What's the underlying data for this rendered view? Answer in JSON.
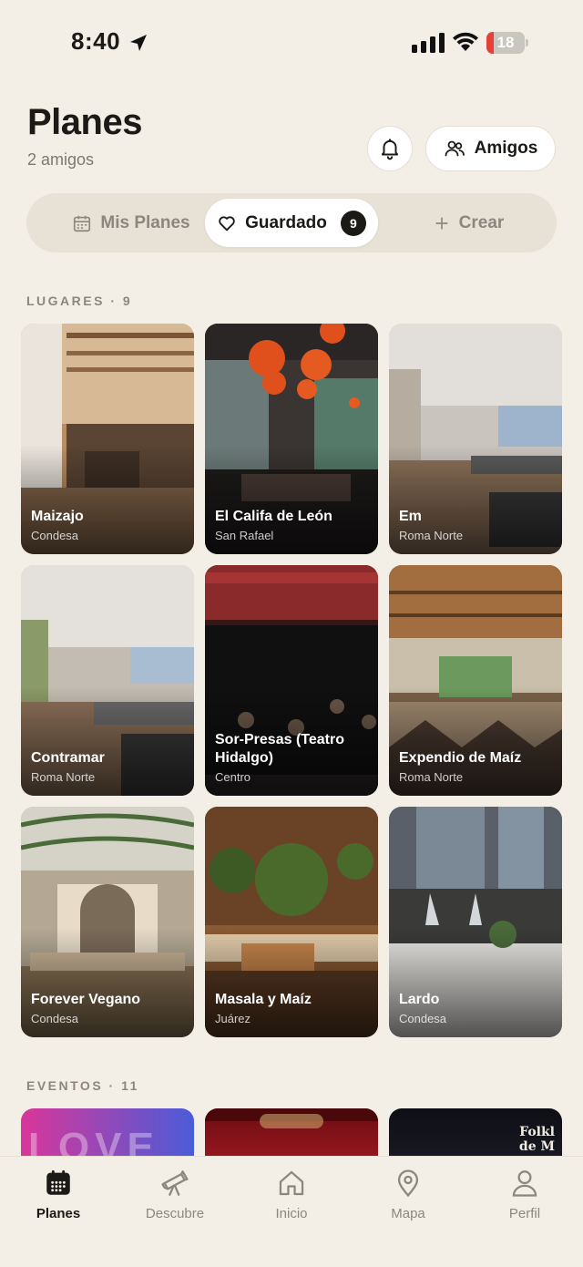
{
  "status": {
    "time": "8:40",
    "battery": "18",
    "battery_percent": 18
  },
  "header": {
    "title": "Planes",
    "subtitle": "2 amigos",
    "friends_button": "Amigos"
  },
  "tabs": [
    {
      "label": "Mis Planes",
      "icon": "calendar-icon",
      "selected": false
    },
    {
      "label": "Guardado",
      "icon": "heart-icon",
      "selected": true,
      "badge": "9"
    },
    {
      "label": "Crear",
      "icon": "plus-icon",
      "selected": false
    }
  ],
  "places_section": {
    "title": "LUGARES · 9"
  },
  "places": [
    {
      "name": "Maizajo",
      "area": "Condesa"
    },
    {
      "name": "El Califa de León",
      "area": "San Rafael"
    },
    {
      "name": "Em",
      "area": "Roma Norte"
    },
    {
      "name": "Contramar",
      "area": "Roma Norte"
    },
    {
      "name": "Sor-Presas (Teatro Hidalgo)",
      "area": "Centro"
    },
    {
      "name": "Expendio de Maíz",
      "area": "Roma Norte"
    },
    {
      "name": "Forever Vegano",
      "area": "Condesa"
    },
    {
      "name": "Masala y Maíz",
      "area": "Juárez"
    },
    {
      "name": "Lardo",
      "area": "Condesa"
    }
  ],
  "events_section": {
    "title": "EVENTOS · 11"
  },
  "events_preview": [
    {
      "visible_text": "LOVE"
    },
    {
      "visible_text": ""
    },
    {
      "visible_text": "Folkl de M"
    }
  ],
  "nav": [
    {
      "label": "Planes",
      "icon": "calendar-icon",
      "active": true
    },
    {
      "label": "Descubre",
      "icon": "telescope-icon",
      "active": false
    },
    {
      "label": "Inicio",
      "icon": "home-icon",
      "active": false
    },
    {
      "label": "Mapa",
      "icon": "map-pin-icon",
      "active": false
    },
    {
      "label": "Perfil",
      "icon": "person-icon",
      "active": false
    }
  ]
}
